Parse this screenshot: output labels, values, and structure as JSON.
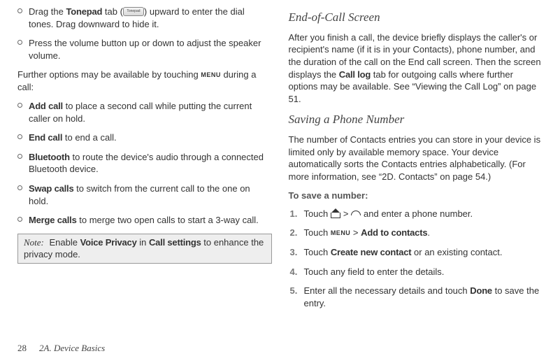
{
  "left": {
    "bullets_top": [
      {
        "prefix": "Drag the ",
        "bold": "Tonepad",
        "mid": " tab (",
        "btn": "Tonepad",
        "after_btn": ") upward to enter the dial tones. Drag downward to hide it."
      },
      {
        "text": "Press the volume button up or down to adjust the speaker volume."
      }
    ],
    "para_before_menu": "Further options may be available by touching ",
    "para_after_menu": " during a call:",
    "menu_glyph": "MENU",
    "bullets_bottom": [
      {
        "bold": "Add call",
        "text": " to place a second call while putting the current caller on hold."
      },
      {
        "bold": "End call",
        "text": " to end a call."
      },
      {
        "bold": "Bluetooth",
        "text": " to route the device's audio through a connected Bluetooth device."
      },
      {
        "bold": "Swap calls",
        "text": " to switch from the current call to the one on hold."
      },
      {
        "bold": "Merge calls",
        "text": " to merge two open calls to start a 3-way call."
      }
    ],
    "note": {
      "label": "Note:",
      "before1": "Enable ",
      "bold1": "Voice Privacy",
      "mid": " in ",
      "bold2": "Call settings",
      "after": " to enhance the privacy mode."
    }
  },
  "right": {
    "h1": "End-of-Call Screen",
    "p1a": "After you finish a call, the device briefly displays the caller's or recipient's name (if it is in your Contacts), phone number, and the duration of the call on the End call screen. Then the screen displays the ",
    "p1_bold": "Call log",
    "p1b": " tab for outgoing calls where further options may be available. See “Viewing the Call Log” on page 51.",
    "h2": "Saving a Phone Number",
    "p2": "The number of Contacts entries you can store in your device is limited only by available memory space. Your device automatically sorts the Contacts entries alphabetically. (For more information, see “2D. Contacts” on page 54.)",
    "subhead": "To save a number:",
    "steps": [
      {
        "num": "1.",
        "a": "Touch ",
        "icons": true,
        "b": "  and enter a phone number."
      },
      {
        "num": "2.",
        "a": "Touch ",
        "menu": true,
        "gt": " > ",
        "bold": "Add to contacts",
        "b": "."
      },
      {
        "num": "3.",
        "a": "Touch ",
        "bold": "Create new contact",
        "b": " or an existing contact."
      },
      {
        "num": "4.",
        "a": "Touch any field to enter the details."
      },
      {
        "num": "5.",
        "a": "Enter all the necessary details and touch ",
        "bold": "Done",
        "b": " to save the entry."
      }
    ],
    "gt": ">"
  },
  "footer": {
    "page": "28",
    "section": "2A. Device Basics"
  }
}
